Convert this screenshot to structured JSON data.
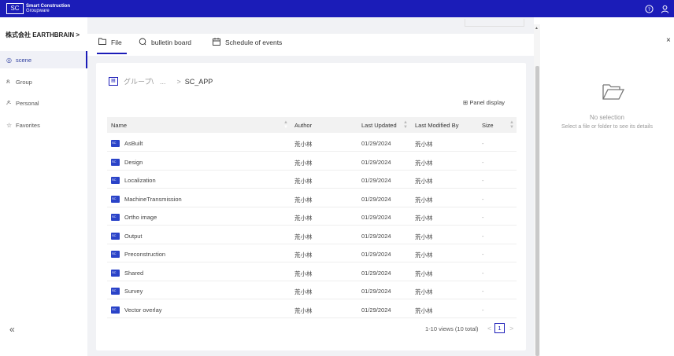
{
  "app": {
    "logo_mark": "SC",
    "logo_line1": "Smart Construction",
    "logo_line2": "Groupware"
  },
  "topbar": {
    "help_icon": "help-circle-icon",
    "user_icon": "user-icon"
  },
  "sidebar": {
    "company": "株式会社 EARTHBRAIN  >",
    "items": [
      {
        "label": "scene",
        "icon": "map-pin-icon",
        "active": true
      },
      {
        "label": "Group",
        "icon": "group-icon",
        "active": false
      },
      {
        "label": "Personal",
        "icon": "person-icon",
        "active": false
      },
      {
        "label": "Favorites",
        "icon": "star-icon",
        "active": false
      }
    ],
    "collapse_label": "«"
  },
  "tabs": [
    {
      "label": "File",
      "icon": "folder-icon",
      "active": true
    },
    {
      "label": "bulletin board",
      "icon": "chat-icon",
      "active": false
    },
    {
      "label": "Schedule of events",
      "icon": "calendar-icon",
      "active": false
    }
  ],
  "breadcrumb": {
    "root": "グループ\\",
    "ellipsis": "...",
    "separator": ">",
    "current": "SC_APP"
  },
  "panel_display_label": "Panel display",
  "table": {
    "columns": [
      "Name",
      "Author",
      "Last Updated",
      "Last Modified By",
      "Size"
    ],
    "rows": [
      {
        "name": "AsBuilt",
        "author": "荒小林",
        "updated": "01/29/2024",
        "modified_by": "荒小林",
        "size": "-"
      },
      {
        "name": "Design",
        "author": "荒小林",
        "updated": "01/29/2024",
        "modified_by": "荒小林",
        "size": "-"
      },
      {
        "name": "Localization",
        "author": "荒小林",
        "updated": "01/29/2024",
        "modified_by": "荒小林",
        "size": "-"
      },
      {
        "name": "MachineTransmission",
        "author": "荒小林",
        "updated": "01/29/2024",
        "modified_by": "荒小林",
        "size": "-"
      },
      {
        "name": "Ortho image",
        "author": "荒小林",
        "updated": "01/29/2024",
        "modified_by": "荒小林",
        "size": "-"
      },
      {
        "name": "Output",
        "author": "荒小林",
        "updated": "01/29/2024",
        "modified_by": "荒小林",
        "size": "-"
      },
      {
        "name": "Preconstruction",
        "author": "荒小林",
        "updated": "01/29/2024",
        "modified_by": "荒小林",
        "size": "-"
      },
      {
        "name": "Shared",
        "author": "荒小林",
        "updated": "01/29/2024",
        "modified_by": "荒小林",
        "size": "-"
      },
      {
        "name": "Survey",
        "author": "荒小林",
        "updated": "01/29/2024",
        "modified_by": "荒小林",
        "size": "-"
      },
      {
        "name": "Vector overlay",
        "author": "荒小林",
        "updated": "01/29/2024",
        "modified_by": "荒小林",
        "size": "-"
      }
    ]
  },
  "pagination": {
    "summary": "1-10 views (10 total)",
    "current_page": "1",
    "prev": "<",
    "next": ">"
  },
  "right_panel": {
    "title": "No selection",
    "hint": "Select a file or folder to see its details",
    "close": "×"
  }
}
